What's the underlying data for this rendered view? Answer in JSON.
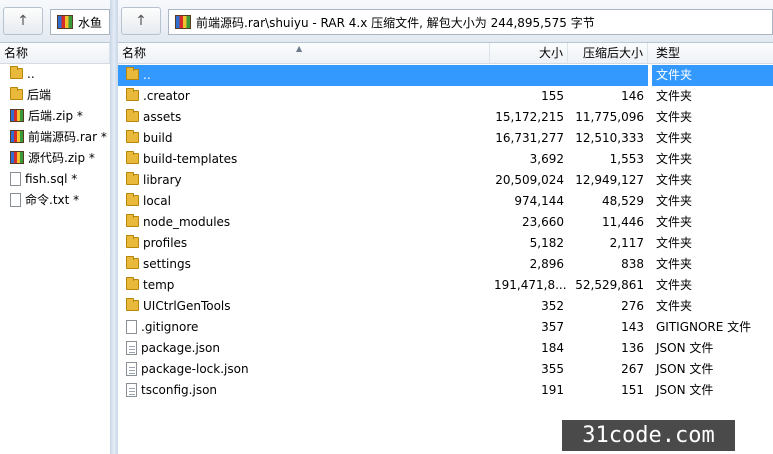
{
  "left_pane": {
    "tab_label": "水鱼",
    "col_name": "名称",
    "items": [
      {
        "name": "..",
        "icon": "folder-icon"
      },
      {
        "name": "后端",
        "icon": "folder-icon"
      },
      {
        "name": "后端.zip *",
        "icon": "rar-icon"
      },
      {
        "name": "前端源码.rar *",
        "icon": "rar-icon"
      },
      {
        "name": "源代码.zip *",
        "icon": "rar-icon"
      },
      {
        "name": "fish.sql *",
        "icon": "doc-icon"
      },
      {
        "name": "命令.txt *",
        "icon": "doc-icon"
      }
    ]
  },
  "right_pane": {
    "path": "前端源码.rar\\shuiyu - RAR 4.x 压缩文件, 解包大小为 244,895,575 字节",
    "columns": {
      "name": "名称",
      "size": "大小",
      "packed": "压缩后大小",
      "type": "类型"
    },
    "rows": [
      {
        "name": "..",
        "size": "",
        "packed": "",
        "type": "文件夹",
        "icon": "folder-icon",
        "selected": true
      },
      {
        "name": ".creator",
        "size": "155",
        "packed": "146",
        "type": "文件夹",
        "icon": "folder-icon"
      },
      {
        "name": "assets",
        "size": "15,172,215",
        "packed": "11,775,096",
        "type": "文件夹",
        "icon": "folder-icon"
      },
      {
        "name": "build",
        "size": "16,731,277",
        "packed": "12,510,333",
        "type": "文件夹",
        "icon": "folder-icon"
      },
      {
        "name": "build-templates",
        "size": "3,692",
        "packed": "1,553",
        "type": "文件夹",
        "icon": "folder-icon"
      },
      {
        "name": "library",
        "size": "20,509,024",
        "packed": "12,949,127",
        "type": "文件夹",
        "icon": "folder-icon"
      },
      {
        "name": "local",
        "size": "974,144",
        "packed": "48,529",
        "type": "文件夹",
        "icon": "folder-icon"
      },
      {
        "name": "node_modules",
        "size": "23,660",
        "packed": "11,446",
        "type": "文件夹",
        "icon": "folder-icon"
      },
      {
        "name": "profiles",
        "size": "5,182",
        "packed": "2,117",
        "type": "文件夹",
        "icon": "folder-icon"
      },
      {
        "name": "settings",
        "size": "2,896",
        "packed": "838",
        "type": "文件夹",
        "icon": "folder-icon"
      },
      {
        "name": "temp",
        "size": "191,471,8...",
        "packed": "52,529,861",
        "type": "文件夹",
        "icon": "folder-icon"
      },
      {
        "name": "UICtrlGenTools",
        "size": "352",
        "packed": "276",
        "type": "文件夹",
        "icon": "folder-icon"
      },
      {
        "name": ".gitignore",
        "size": "357",
        "packed": "143",
        "type": "GITIGNORE 文件",
        "icon": "doc-icon"
      },
      {
        "name": "package.json",
        "size": "184",
        "packed": "136",
        "type": "JSON 文件",
        "icon": "json-file-icon"
      },
      {
        "name": "package-lock.json",
        "size": "355",
        "packed": "267",
        "type": "JSON 文件",
        "icon": "json-file-icon"
      },
      {
        "name": "tsconfig.json",
        "size": "191",
        "packed": "151",
        "type": "JSON 文件",
        "icon": "json-file-icon"
      }
    ]
  },
  "up_arrow": "↑",
  "watermark": "31code.com"
}
